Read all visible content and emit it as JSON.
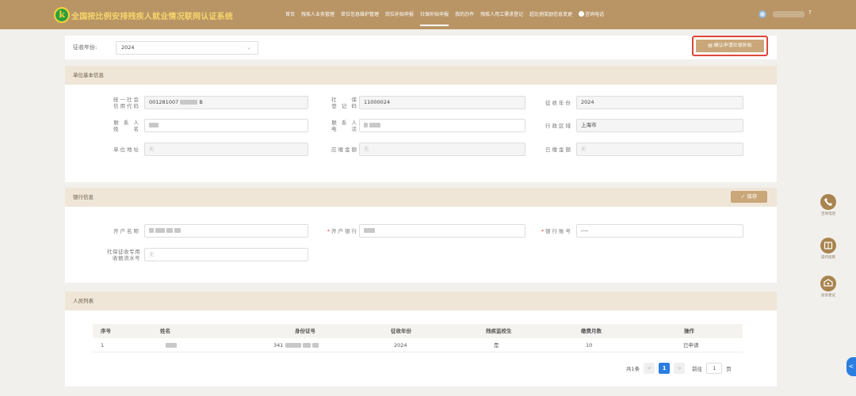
{
  "header": {
    "logo_char": "k",
    "title": "全国按比例安排残疾人就业情况联网认证系统",
    "nav": [
      {
        "label": "首页"
      },
      {
        "label": "残疾人业务管理"
      },
      {
        "label": "单位信息维护管理"
      },
      {
        "label": "岗位补贴申报"
      },
      {
        "label": "社保补贴申报",
        "active": true
      },
      {
        "label": "我的办件"
      },
      {
        "label": "残疾人用工需求登记"
      },
      {
        "label": "超比例奖励信息变更"
      },
      {
        "label": "咨询电话",
        "icon": "phone-icon"
      }
    ],
    "help": "?"
  },
  "filter": {
    "label": "征收年份:",
    "year": "2024",
    "confirm_button": "确认申请社保补贴"
  },
  "unit_info": {
    "title": "单位基本信息",
    "credit_code_label": [
      "统一社会",
      "信用代码"
    ],
    "credit_code_value": "001281007",
    "credit_code_suffix": "B",
    "social_reg_label": [
      "社　　保",
      "登 记 码"
    ],
    "social_reg_value": "11000024",
    "year_label": "征收年份",
    "year_value": "2024",
    "contact_name_label": [
      "联 系 人",
      "姓　　名"
    ],
    "contact_phone_label": [
      "联 系 人",
      "电　　话"
    ],
    "district_label": "行政区域",
    "district_value": "上海市",
    "address_label": "单位地址",
    "address_value": "无",
    "payable_label": "应缴金额",
    "payable_value": "无",
    "paid_label": "已缴金额",
    "paid_value": "无"
  },
  "bank_info": {
    "title": "银行信息",
    "save_button": "保存",
    "account_name_label": "开户名称",
    "account_name_prefix": "",
    "bank_label": "开户银行",
    "bank_prefix": "",
    "account_no_label": "银行账号",
    "account_no_value": "----",
    "serial_label": [
      "社保征收专用",
      "收据流水号"
    ],
    "serial_value": "无"
  },
  "people": {
    "title": "人员列表",
    "columns": [
      "序号",
      "姓名",
      "身份证号",
      "征收年份",
      "残疾监校生",
      "缴费月数",
      "操作"
    ],
    "rows": [
      {
        "no": "1",
        "id_prefix": "341",
        "year": "2024",
        "flag": "是",
        "months": "10",
        "action": "已申请"
      }
    ],
    "pager": {
      "total": "共1条",
      "prev": "<",
      "page": "1",
      "next": ">",
      "goto": "前往",
      "goto_value": "1",
      "unit": "页"
    }
  },
  "tools": [
    {
      "icon": "phone-icon",
      "label": "咨询电话"
    },
    {
      "icon": "manual-icon",
      "label": "操作指南"
    },
    {
      "icon": "feedback-icon",
      "label": "投诉建议"
    }
  ],
  "side_tab": "<"
}
